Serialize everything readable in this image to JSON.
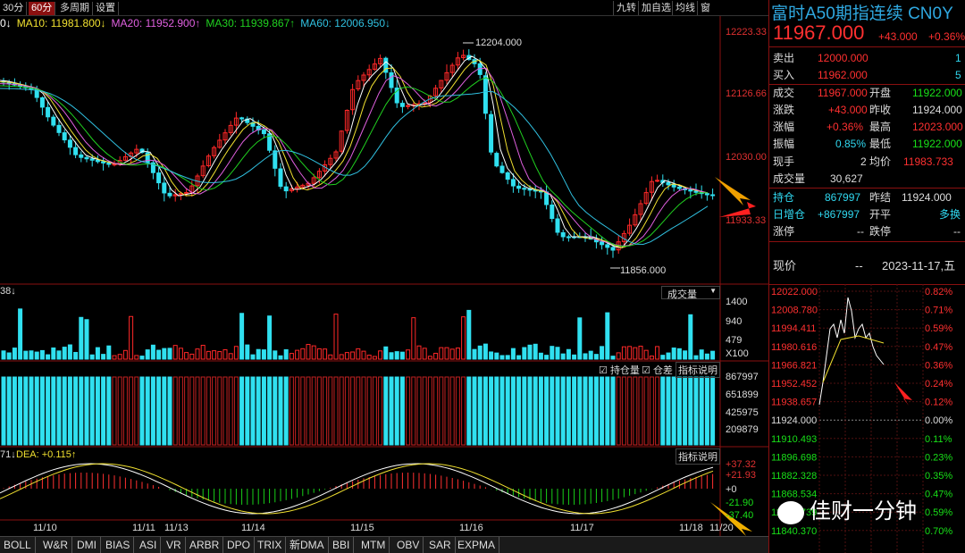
{
  "toolbar": {
    "periods": [
      "30分",
      "60分",
      "多周期",
      "设置"
    ],
    "active_period": "60分",
    "tools": [
      "九转",
      "加自选",
      "均线",
      "窗"
    ]
  },
  "ma": {
    "ma5_prefix": "0↓",
    "ma10": "MA10: 11981.800↓",
    "ma20": "MA20: 11952.900↑",
    "ma30": "MA30: 11939.867↑",
    "ma60": "MA60: 12006.950↓",
    "colors": {
      "ma5": "#ffffff",
      "ma10": "#f0e030",
      "ma20": "#e060e0",
      "ma30": "#20d020",
      "ma60": "#30c0e0"
    }
  },
  "price_axis": [
    "12223.33",
    "12126.66",
    "12030.00",
    "11933.33"
  ],
  "annotations": {
    "high": "12204.000",
    "low": "11856.000"
  },
  "volume": {
    "label_left": "38↓",
    "dropdown": "成交量",
    "axis": [
      "1400",
      "940",
      "479",
      "X100"
    ]
  },
  "oi": {
    "chk1": "持仓量",
    "chk2": "仓差",
    "button": "指标说明",
    "axis": [
      "867997",
      "651899",
      "425975",
      "209879"
    ]
  },
  "macd": {
    "label_left": "71↓",
    "dea": "DEA: +0.115↑",
    "button": "指标说明",
    "axis": [
      "+37.32",
      "+21.93",
      "+0",
      "-21.90",
      "-37.40"
    ]
  },
  "dates": [
    "11/10",
    "11/11",
    "11/13",
    "11/14",
    "11/15",
    "11/16",
    "11/17",
    "11/18",
    "11/20"
  ],
  "bottom_tabs": [
    "BOLL",
    "W&R",
    "DMI",
    "BIAS",
    "ASI",
    "VR",
    "ARBR",
    "DPO",
    "TRIX",
    "新DMA",
    "BBI",
    "MTM",
    "OBV",
    "SAR",
    "EXPMA"
  ],
  "panel": {
    "title": "富时A50期指连续 CN0Y",
    "price": "11967.000",
    "change": "+43.000",
    "change_pct": "+0.36%",
    "ask_label": "卖出",
    "ask": "12000.000",
    "ask_vol": "1",
    "bid_label": "买入",
    "bid": "11962.000",
    "bid_vol": "5",
    "stats": [
      {
        "l1": "成交",
        "v1": "11967.000",
        "l2": "开盘",
        "v2": "11922.000"
      },
      {
        "l1": "涨跌",
        "v1": "+43.000",
        "l2": "昨收",
        "v2": "11924.000"
      },
      {
        "l1": "涨幅",
        "v1": "+0.36%",
        "l2": "最高",
        "v2": "12023.000"
      },
      {
        "l1": "振幅",
        "v1": "0.85%",
        "l2": "最低",
        "v2": "11922.000"
      },
      {
        "l1": "现手",
        "v1": "2",
        "l2": "均价",
        "v2": "11983.733"
      }
    ],
    "volume_label": "成交量",
    "volume": "30,627",
    "hold_label": "持仓",
    "hold": "867997",
    "prev_settle_label": "昨结",
    "prev_settle": "11924.000",
    "daily_oi_label": "日增仓",
    "daily_oi": "+867997",
    "openclose_label": "开平",
    "openclose": "多换",
    "limit_up_label": "涨停",
    "limit_up": "--",
    "limit_down_label": "跌停",
    "limit_down": "--",
    "now_label": "现价",
    "now_val": "--",
    "date": "2023-11-17,五",
    "mini_left": [
      "12022.000",
      "12008.780",
      "11994.411",
      "11980.616",
      "11966.821",
      "11952.452",
      "11938.657",
      "11924.000",
      "11910.493",
      "11896.698",
      "11882.328",
      "11868.534",
      "11854.739",
      "11840.370"
    ],
    "mini_right": [
      "0.82%",
      "0.71%",
      "0.59%",
      "0.47%",
      "0.36%",
      "0.24%",
      "0.12%",
      "0.00%",
      "0.11%",
      "0.23%",
      "0.35%",
      "0.47%",
      "0.59%",
      "0.70%"
    ]
  },
  "watermark": "佳财一分钟"
}
